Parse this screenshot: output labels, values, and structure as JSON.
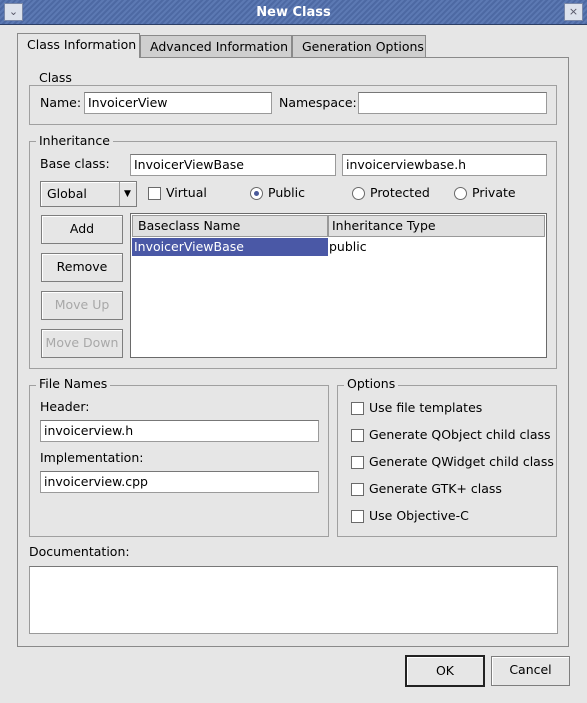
{
  "window": {
    "title": "New Class"
  },
  "tabs": [
    {
      "label": "Class Information",
      "active": true
    },
    {
      "label": "Advanced Information",
      "active": false
    },
    {
      "label": "Generation Options",
      "active": false
    }
  ],
  "class_group": {
    "title": "Class",
    "name_label": "Name:",
    "name_value": "InvoicerView",
    "namespace_label": "Namespace:",
    "namespace_value": ""
  },
  "inheritance": {
    "title": "Inheritance",
    "base_class_label": "Base class:",
    "base_class_value": "InvoicerViewBase",
    "header_value": "invoicerviewbase.h",
    "scope_select": "Global",
    "virtual_label": "Virtual",
    "virtual_checked": false,
    "access": [
      {
        "label": "Public",
        "selected": true
      },
      {
        "label": "Protected",
        "selected": false
      },
      {
        "label": "Private",
        "selected": false
      }
    ],
    "buttons": {
      "add": "Add",
      "remove": "Remove",
      "move_up": "Move Up",
      "move_down": "Move Down"
    },
    "columns": [
      "Baseclass Name",
      "Inheritance Type"
    ],
    "rows": [
      {
        "name": "InvoicerViewBase",
        "type": "public",
        "selected": true
      }
    ]
  },
  "file_names": {
    "title": "File Names",
    "header_label": "Header:",
    "header_value": "invoicerview.h",
    "impl_label": "Implementation:",
    "impl_value": "invoicerview.cpp"
  },
  "options": {
    "title": "Options",
    "items": [
      {
        "label": "Use file templates",
        "checked": false
      },
      {
        "label": "Generate QObject child class",
        "checked": false
      },
      {
        "label": "Generate QWidget child class",
        "checked": false
      },
      {
        "label": "Generate GTK+ class",
        "checked": false
      },
      {
        "label": "Use Objective-C",
        "checked": false
      }
    ]
  },
  "documentation": {
    "label": "Documentation:",
    "value": ""
  },
  "footer": {
    "ok": "OK",
    "cancel": "Cancel"
  },
  "colors": {
    "titlebar": "#4d69a3",
    "selection": "#4a58a6",
    "background": "#e6e6e6"
  }
}
